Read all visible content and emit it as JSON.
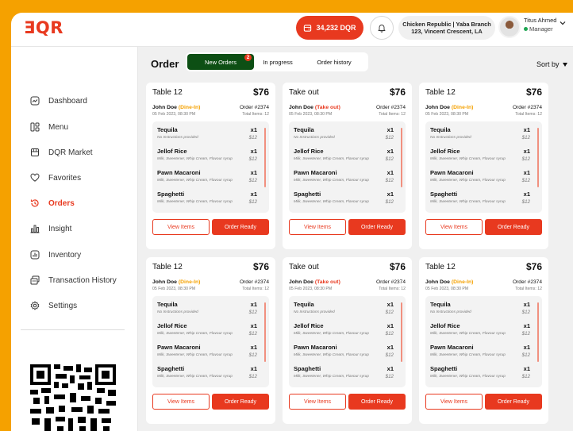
{
  "app": {
    "logo": "ƎQR"
  },
  "header": {
    "balance": "34,232 DQR",
    "branch_line1": "Chicken Republic | Yaba Branch",
    "branch_line2": "123, Vincent Crescent, LA",
    "user_name": "Titus Ahmed",
    "user_role": "Manager"
  },
  "sidebar": {
    "items": [
      {
        "label": "Dashboard",
        "icon": "dashboard-icon",
        "active": false
      },
      {
        "label": "Menu",
        "icon": "menu-icon",
        "active": false
      },
      {
        "label": "DQR Market",
        "icon": "store-icon",
        "active": false
      },
      {
        "label": "Favorites",
        "icon": "heart-icon",
        "active": false
      },
      {
        "label": "Orders",
        "icon": "history-icon",
        "active": true
      },
      {
        "label": "Insight",
        "icon": "bar-chart-icon",
        "active": false
      },
      {
        "label": "Inventory",
        "icon": "inventory-icon",
        "active": false
      },
      {
        "label": "Transaction History",
        "icon": "transaction-icon",
        "active": false
      },
      {
        "label": "Settings",
        "icon": "gear-icon",
        "active": false
      }
    ]
  },
  "main": {
    "title": "Order",
    "tabs": [
      {
        "label": "New Orders",
        "badge": "2",
        "active": true
      },
      {
        "label": "In progress",
        "active": false
      },
      {
        "label": "Order history",
        "active": false
      }
    ],
    "sort_label": "Sort by"
  },
  "cards": [
    {
      "title": "Table 12",
      "price": "$76",
      "customer": "John Doe",
      "type": "(Dine-In)",
      "order_no": "Order #2374",
      "date": "05 Feb 2023, 08:30 PM",
      "total": "Total Items: 12",
      "items": [
        {
          "name": "Tequila",
          "note": "No Instructions provided",
          "qty": "x1",
          "price": "$12"
        },
        {
          "name": "Jellof Rice",
          "note": "Milk, Sweetener, Whip Cream, Flavour syrup",
          "qty": "x1",
          "price": "$12"
        },
        {
          "name": "Pawn Macaroni",
          "note": "Milk, Sweetener, Whip Cream, Flavour syrup",
          "qty": "x1",
          "price": "$12"
        },
        {
          "name": "Spaghetti",
          "note": "Milk, Sweetener, Whip Cream, Flavour syrup",
          "qty": "x1",
          "price": "$12"
        }
      ],
      "view_label": "View Items",
      "ready_label": "Order Ready"
    },
    {
      "title": "Take out",
      "price": "$76",
      "customer": "John Doe",
      "type": "(Take out)",
      "order_no": "Order #2374",
      "date": "05 Feb 2023, 08:30 PM",
      "total": "Total Items: 12",
      "items": [
        {
          "name": "Tequila",
          "note": "No Instructions provided",
          "qty": "x1",
          "price": "$12"
        },
        {
          "name": "Jellof Rice",
          "note": "Milk, Sweetener, Whip Cream, Flavour syrup",
          "qty": "x1",
          "price": "$12"
        },
        {
          "name": "Pawn Macaroni",
          "note": "Milk, Sweetener, Whip Cream, Flavour syrup",
          "qty": "x1",
          "price": "$12"
        },
        {
          "name": "Spaghetti",
          "note": "Milk, Sweetener, Whip Cream, Flavour syrup",
          "qty": "x1",
          "price": "$12"
        }
      ],
      "view_label": "View Items",
      "ready_label": "Order Ready"
    },
    {
      "title": "Table 12",
      "price": "$76",
      "customer": "John Doe",
      "type": "(Dine-In)",
      "order_no": "Order #2374",
      "date": "05 Feb 2023, 08:30 PM",
      "total": "Total Items: 12",
      "items": [
        {
          "name": "Tequila",
          "note": "No Instructions provided",
          "qty": "x1",
          "price": "$12"
        },
        {
          "name": "Jellof Rice",
          "note": "Milk, Sweetener, Whip Cream, Flavour syrup",
          "qty": "x1",
          "price": "$12"
        },
        {
          "name": "Pawn Macaroni",
          "note": "Milk, Sweetener, Whip Cream, Flavour syrup",
          "qty": "x1",
          "price": "$12"
        },
        {
          "name": "Spaghetti",
          "note": "Milk, Sweetener, Whip Cream, Flavour syrup",
          "qty": "x1",
          "price": "$12"
        }
      ],
      "view_label": "View Items",
      "ready_label": "Order Ready"
    },
    {
      "title": "Table 12",
      "price": "$76",
      "customer": "John Doe",
      "type": "(Dine-In)",
      "order_no": "Order #2374",
      "date": "05 Feb 2023, 08:30 PM",
      "total": "Total Items: 12",
      "items": [
        {
          "name": "Tequila",
          "note": "No Instructions provided",
          "qty": "x1",
          "price": "$12"
        },
        {
          "name": "Jellof Rice",
          "note": "Milk, Sweetener, Whip Cream, Flavour syrup",
          "qty": "x1",
          "price": "$12"
        },
        {
          "name": "Pawn Macaroni",
          "note": "Milk, Sweetener, Whip Cream, Flavour syrup",
          "qty": "x1",
          "price": "$12"
        },
        {
          "name": "Spaghetti",
          "note": "Milk, Sweetener, Whip Cream, Flavour syrup",
          "qty": "x1",
          "price": "$12"
        }
      ],
      "view_label": "View Items",
      "ready_label": "Order Ready"
    },
    {
      "title": "Take out",
      "price": "$76",
      "customer": "John Doe",
      "type": "(Take out)",
      "order_no": "Order #2374",
      "date": "05 Feb 2023, 08:30 PM",
      "total": "Total Items: 12",
      "items": [
        {
          "name": "Tequila",
          "note": "No Instructions provided",
          "qty": "x1",
          "price": "$12"
        },
        {
          "name": "Jellof Rice",
          "note": "Milk, Sweetener, Whip Cream, Flavour syrup",
          "qty": "x1",
          "price": "$12"
        },
        {
          "name": "Pawn Macaroni",
          "note": "Milk, Sweetener, Whip Cream, Flavour syrup",
          "qty": "x1",
          "price": "$12"
        },
        {
          "name": "Spaghetti",
          "note": "Milk, Sweetener, Whip Cream, Flavour syrup",
          "qty": "x1",
          "price": "$12"
        }
      ],
      "view_label": "View Items",
      "ready_label": "Order Ready"
    },
    {
      "title": "Table 12",
      "price": "$76",
      "customer": "John Doe",
      "type": "(Dine-In)",
      "order_no": "Order #2374",
      "date": "05 Feb 2023, 08:30 PM",
      "total": "Total Items: 12",
      "items": [
        {
          "name": "Tequila",
          "note": "No Instructions provided",
          "qty": "x1",
          "price": "$12"
        },
        {
          "name": "Jellof Rice",
          "note": "Milk, Sweetener, Whip Cream, Flavour syrup",
          "qty": "x1",
          "price": "$12"
        },
        {
          "name": "Pawn Macaroni",
          "note": "Milk, Sweetener, Whip Cream, Flavour syrup",
          "qty": "x1",
          "price": "$12"
        },
        {
          "name": "Spaghetti",
          "note": "Milk, Sweetener, Whip Cream, Flavour syrup",
          "qty": "x1",
          "price": "$12"
        }
      ],
      "view_label": "View Items",
      "ready_label": "Order Ready"
    }
  ],
  "colors": {
    "accent": "#e8391f",
    "brand_bg": "#f5a100",
    "active_tab": "#0d4f14",
    "dine_in": "#f5a100",
    "take_out": "#e8391f"
  }
}
